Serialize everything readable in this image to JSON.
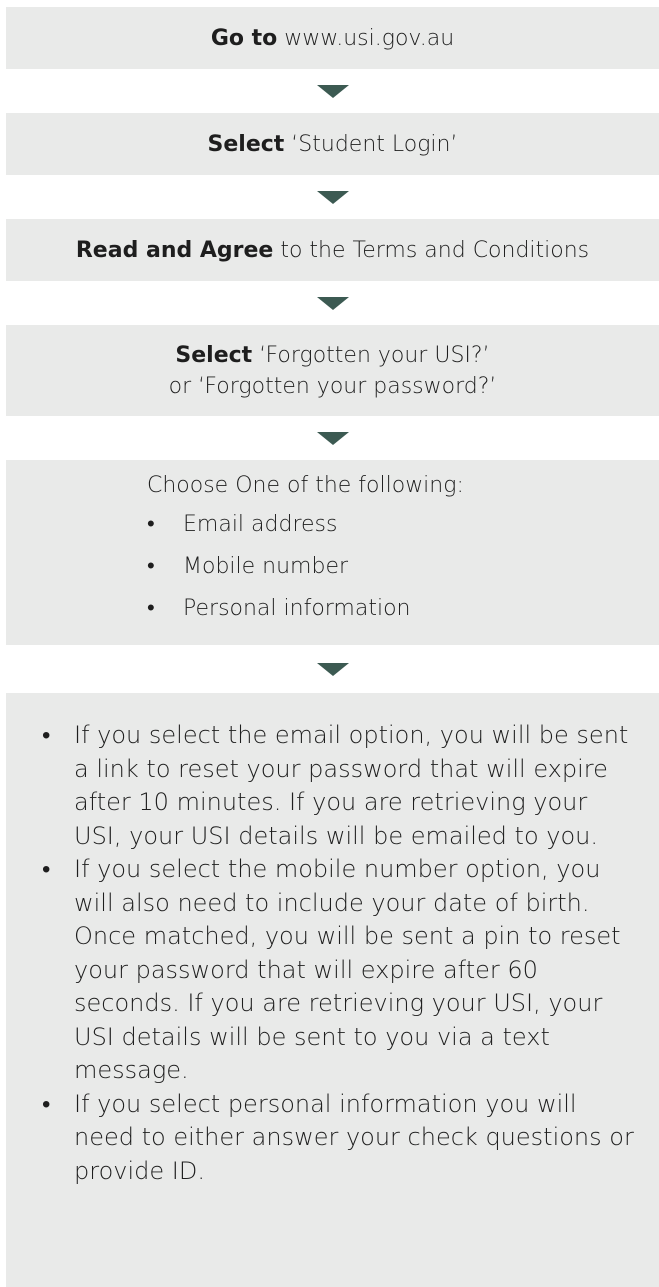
{
  "steps": [
    {
      "bold": "Go to",
      "text": " www.usi.gov.au"
    },
    {
      "bold": "Select",
      "text": " ‘Student Login’"
    },
    {
      "bold": "Read and Agree",
      "text": " to the Terms and Conditions"
    },
    {
      "bold": "Select",
      "text": " ‘Forgotten your USI?’",
      "line2": "or ‘Forgotten your password?’"
    }
  ],
  "choose": {
    "title": "Choose One of the following:",
    "options": [
      "Email address",
      "Mobile number",
      "Personal information"
    ]
  },
  "details": [
    "If you select the email option, you will be sent a link to reset your password that will expire after 10 minutes. If you are retrieving your USI, your USI details will be emailed to you.",
    "If you select the mobile number option, you will also need to include your date of birth. Once matched, you will be sent a pin to reset your password that will expire after 60 seconds. If you are retrieving your USI, your USI details will be sent to you via a text message.",
    "If you select personal information you will need to either answer your check questions or provide ID."
  ],
  "bullet": "•",
  "colors": {
    "box": "#e9eae9",
    "arrow": "#3c5a52",
    "text": "#1e1e1e"
  }
}
